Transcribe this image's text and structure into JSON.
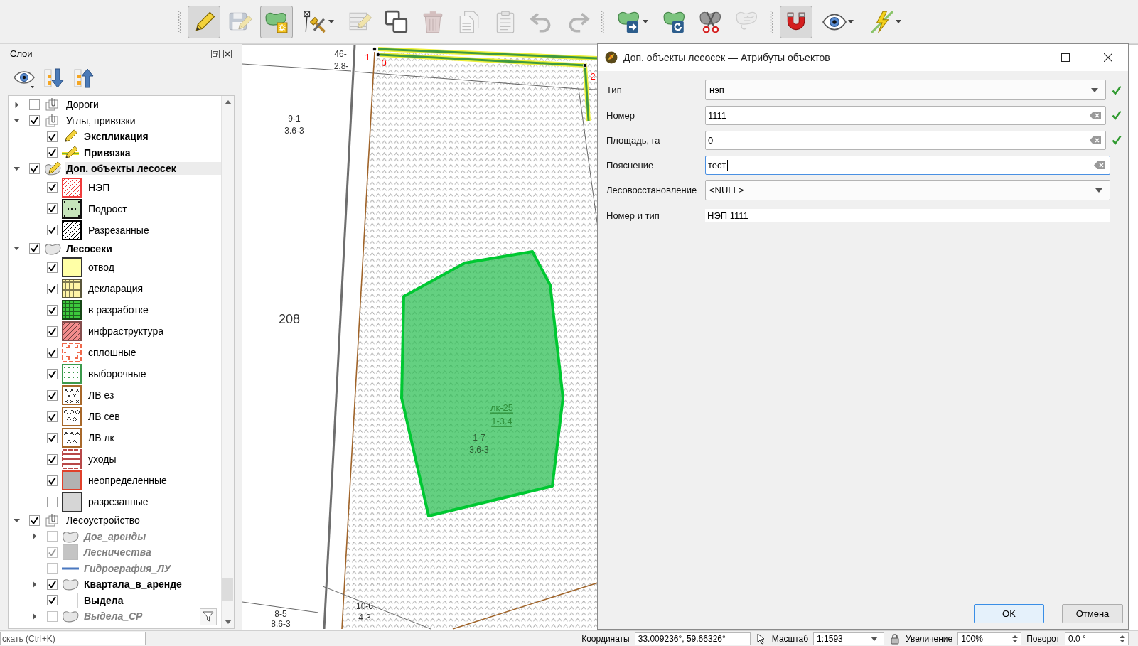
{
  "toolbar": {
    "groups": [
      {
        "buttons": [
          {
            "kind": "pencil",
            "pressed": true,
            "disabled": false,
            "menu": false
          },
          {
            "kind": "save",
            "pressed": false,
            "disabled": true,
            "menu": false
          },
          {
            "kind": "polygon",
            "pressed": true,
            "disabled": false,
            "menu": false
          },
          {
            "kind": "vertex",
            "pressed": false,
            "disabled": false,
            "menu": true
          },
          {
            "kind": "attributes",
            "pressed": false,
            "disabled": true,
            "menu": false
          },
          {
            "kind": "copy",
            "pressed": false,
            "disabled": false,
            "menu": false
          },
          {
            "kind": "delete",
            "pressed": false,
            "disabled": true,
            "menu": false
          },
          {
            "kind": "duplicate",
            "pressed": false,
            "disabled": true,
            "menu": false
          },
          {
            "kind": "paste",
            "pressed": false,
            "disabled": true,
            "menu": false
          },
          {
            "kind": "undo",
            "pressed": false,
            "disabled": true,
            "menu": false
          },
          {
            "kind": "redo",
            "pressed": false,
            "disabled": true,
            "menu": false
          }
        ]
      },
      {
        "buttons": [
          {
            "kind": "move",
            "pressed": false,
            "disabled": false,
            "menu": true
          },
          {
            "kind": "rotate",
            "pressed": false,
            "disabled": false,
            "menu": false
          },
          {
            "kind": "split",
            "pressed": false,
            "disabled": false,
            "menu": false
          },
          {
            "kind": "merge",
            "pressed": false,
            "disabled": true,
            "menu": false
          }
        ]
      },
      {
        "buttons": [
          {
            "kind": "magnet",
            "pressed": true,
            "disabled": false,
            "menu": false
          },
          {
            "kind": "eye",
            "pressed": false,
            "disabled": false,
            "menu": true
          },
          {
            "kind": "tracing",
            "pressed": false,
            "disabled": false,
            "menu": true
          }
        ]
      }
    ]
  },
  "layers": {
    "title": "Слои",
    "items": [
      {
        "label": "Дороги",
        "kind": "group",
        "checked": false,
        "expanded": false,
        "disabled": false,
        "selected": false
      },
      {
        "label": "Углы, привязки",
        "kind": "group",
        "checked": true,
        "expanded": true,
        "disabled": false,
        "selected": false,
        "children": [
          {
            "label": "Экспликация",
            "kind": "pencil",
            "checked": true,
            "disabled": false,
            "selected": false
          },
          {
            "label": "Привязка",
            "kind": "pencil-line",
            "checked": true,
            "disabled": false,
            "selected": false
          }
        ]
      },
      {
        "label": "Доп. объекты лесосек",
        "kind": "editing",
        "checked": true,
        "expanded": true,
        "disabled": false,
        "selected": true,
        "children": [
          {
            "label": "НЭП",
            "kind": "hatch",
            "color": "#f03c3c",
            "checked": true,
            "disabled": false,
            "selected": false
          },
          {
            "label": "Подрост",
            "kind": "dots",
            "color": "#c6e4bb",
            "checked": true,
            "disabled": false,
            "selected": false
          },
          {
            "label": "Разрезанные",
            "kind": "hatch",
            "color": "#000000",
            "checked": true,
            "disabled": false,
            "selected": false
          }
        ]
      },
      {
        "label": "Лесосеки",
        "kind": "polygon",
        "checked": true,
        "expanded": true,
        "disabled": false,
        "selected": false,
        "children": [
          {
            "label": "отвод",
            "kind": "fill",
            "color": "#ffffa6",
            "checked": true,
            "disabled": false,
            "selected": false
          },
          {
            "label": "декларация",
            "kind": "grid",
            "color": "#fff4a6",
            "checked": true,
            "disabled": false,
            "selected": false
          },
          {
            "label": "в разработке",
            "kind": "grid",
            "color": "#3cc83c",
            "checked": true,
            "disabled": false,
            "selected": false
          },
          {
            "label": "инфраструктура",
            "kind": "shaded",
            "color": "#f28c8c",
            "checked": true,
            "disabled": false,
            "selected": false
          },
          {
            "label": "сплошные",
            "kind": "corners",
            "color": "#f0684a",
            "checked": true,
            "disabled": false,
            "selected": false
          },
          {
            "label": "выборочные",
            "kind": "speckle",
            "color": "#3c9a4c",
            "checked": true,
            "disabled": false,
            "selected": false
          },
          {
            "label": "ЛВ ез",
            "kind": "crosses",
            "color": "#a8682a",
            "checked": true,
            "disabled": false,
            "selected": false
          },
          {
            "label": "ЛВ сев",
            "kind": "circles",
            "color": "#a8682a",
            "checked": true,
            "disabled": false,
            "selected": false
          },
          {
            "label": "ЛВ лк",
            "kind": "carets",
            "color": "#a8682a",
            "checked": true,
            "disabled": false,
            "selected": false
          },
          {
            "label": "уходы",
            "kind": "stripes",
            "color": "#b84848",
            "checked": true,
            "disabled": false,
            "selected": false
          },
          {
            "label": "неопределенные",
            "kind": "framed",
            "color": "#e0402a",
            "checked": true,
            "disabled": false,
            "selected": false
          },
          {
            "label": "разрезанные",
            "kind": "fill",
            "color": "#d6d6d6",
            "checked": false,
            "disabled": false,
            "selected": false
          }
        ]
      },
      {
        "label": "Лесоустройство",
        "kind": "group",
        "checked": true,
        "expanded": true,
        "disabled": false,
        "selected": false,
        "children": [
          {
            "label": "Дог_аренды",
            "kind": "polygon",
            "checked": false,
            "expanded": false,
            "disabled": true,
            "selected": false
          },
          {
            "label": "Лесничества",
            "kind": "square",
            "color": "#c4c4c4",
            "checked": true,
            "disabled": true,
            "selected": false
          },
          {
            "label": "Гидрография_ЛУ",
            "kind": "line",
            "color": "#4a78c0",
            "checked": false,
            "disabled": true,
            "selected": false
          },
          {
            "label": "Квартала_в_аренде",
            "kind": "polygon",
            "checked": true,
            "expanded": false,
            "disabled": false,
            "selected": false
          },
          {
            "label": "Выдела",
            "kind": "outline",
            "checked": true,
            "disabled": false,
            "selected": false
          },
          {
            "label": "Выдела_СР",
            "kind": "polygon",
            "checked": false,
            "expanded": false,
            "disabled": true,
            "selected": false
          }
        ]
      }
    ]
  },
  "map": {
    "labels": [
      {
        "text": "46-",
        "kind": "label",
        "color": "#333333"
      },
      {
        "text": "2.8-",
        "kind": "label",
        "color": "#333333"
      },
      {
        "text": "1",
        "kind": "vertex",
        "color": "#ff0000"
      },
      {
        "text": "0",
        "kind": "vertex",
        "color": "#ff0000"
      },
      {
        "text": "2",
        "kind": "vertex",
        "color": "#ff0000"
      },
      {
        "text": "9-1",
        "kind": "label",
        "color": "#333333"
      },
      {
        "text": "3.6-3",
        "kind": "label",
        "color": "#333333"
      },
      {
        "text": "208",
        "kind": "number",
        "color": "#333333"
      },
      {
        "text": "лк-25",
        "kind": "feature",
        "color": "#2f8f3a"
      },
      {
        "text": "1-3.4",
        "kind": "feature",
        "color": "#2f8f3a"
      },
      {
        "text": "1-7",
        "kind": "label",
        "color": "#2e5e34"
      },
      {
        "text": "3.6-3",
        "kind": "label",
        "color": "#2e5e34"
      },
      {
        "text": "8-5",
        "kind": "label",
        "color": "#333333"
      },
      {
        "text": "8.6-3",
        "kind": "label",
        "color": "#333333"
      },
      {
        "text": "10-6",
        "kind": "label",
        "color": "#333333"
      },
      {
        "text": "4-3",
        "kind": "label",
        "color": "#333333"
      }
    ]
  },
  "dialog": {
    "title": "Доп. объекты лесосек — Атрибуты объектов",
    "fields": [
      {
        "label": "Тип",
        "kind": "combo",
        "value": "нэп",
        "valid": true,
        "focused": false
      },
      {
        "label": "Номер",
        "kind": "text",
        "value": "1111",
        "valid": true,
        "focused": false
      },
      {
        "label": "Площадь, га",
        "kind": "text",
        "value": "0",
        "valid": true,
        "focused": false
      },
      {
        "label": "Пояснение",
        "kind": "text",
        "value": "тест",
        "valid": false,
        "focused": true
      },
      {
        "label": "Лесовосстановление",
        "kind": "combo",
        "value": "<NULL>",
        "valid": false,
        "focused": false
      },
      {
        "label": "Номер и тип",
        "kind": "readonly",
        "value": "НЭП 1111",
        "valid": false,
        "focused": false
      }
    ],
    "buttons": [
      {
        "label": "OK",
        "default": true
      },
      {
        "label": "Отмена",
        "default": false
      }
    ]
  },
  "status_bar": {
    "search": {
      "placeholder": "скать (Ctrl+K)"
    },
    "fields": [
      {
        "label": "Координаты",
        "kind": "text",
        "value": "33.009236°, 59.66326°"
      },
      {
        "label": "Масштаб",
        "kind": "combo",
        "value": "1:1593"
      },
      {
        "label": "Увеличение",
        "kind": "spin",
        "value": "100%"
      },
      {
        "label": "Поворот",
        "kind": "spin",
        "value": "0.0 °"
      }
    ]
  }
}
